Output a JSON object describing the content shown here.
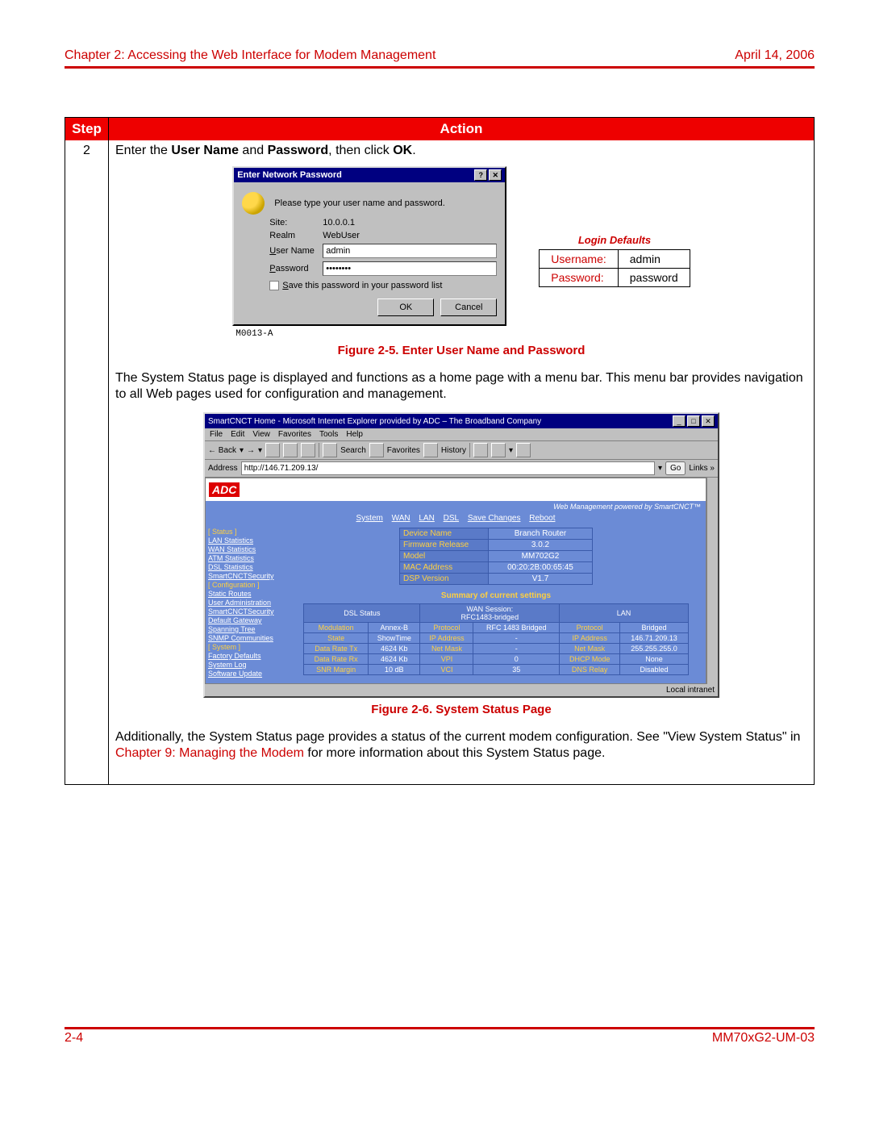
{
  "header": {
    "chapter": "Chapter 2: Accessing the Web Interface for Modem Management",
    "date": "April 14, 2006"
  },
  "table": {
    "header_step": "Step",
    "header_action": "Action",
    "step_num": "2",
    "step_intro_pre": "Enter the ",
    "step_intro_b1": "User Name",
    "step_intro_mid": " and ",
    "step_intro_b2": "Password",
    "step_intro_mid2": ", then click ",
    "step_intro_b3": "OK",
    "step_intro_end": "."
  },
  "dialog": {
    "title": "Enter Network Password",
    "help_btn": "?",
    "close_btn": "✕",
    "prompt": "Please type your user name and password.",
    "site_label": "Site:",
    "site_value": "10.0.0.1",
    "realm_label": "Realm",
    "realm_value": "WebUser",
    "user_label_pre": "U",
    "user_label": "ser Name",
    "user_value": "admin",
    "pass_label_pre": "P",
    "pass_label": "assword",
    "pass_value": "••••••••",
    "save_pre": "S",
    "save_label": "ave this password in your password list",
    "ok_btn": "OK",
    "cancel_btn": "Cancel",
    "code": "M0013-A"
  },
  "defaults": {
    "title": "Login Defaults",
    "user_label": "Username:",
    "user_value": "admin",
    "pass_label": "Password:",
    "pass_value": "password"
  },
  "caption1": "Figure 2-5. Enter User Name and Password",
  "paragraph1": "The System Status page is displayed and functions as a home page with a menu bar. This menu bar provides navigation to all Web pages used for configuration and management.",
  "browser": {
    "title": "SmartCNCT Home - Microsoft Internet Explorer provided by ADC – The Broadband Company",
    "min": "_",
    "max": "□",
    "close": "✕",
    "menu": [
      "File",
      "Edit",
      "View",
      "Favorites",
      "Tools",
      "Help"
    ],
    "back": "← Back",
    "fwd": "→",
    "search": "Search",
    "favorites": "Favorites",
    "history": "History",
    "addr_label": "Address",
    "addr_value": "http://146.71.209.13/",
    "go": "Go",
    "links": "Links »",
    "logo": "ADC",
    "tagline": "Web Management powered by SmartCNCT™",
    "topnav": [
      "System",
      "WAN",
      "LAN",
      "DSL",
      "Save Changes",
      "Reboot"
    ],
    "sidebar": {
      "cat_status": "[ Status ]",
      "items1": [
        "LAN Statistics",
        "WAN Statistics",
        "ATM Statistics",
        "DSL Statistics",
        "SmartCNCTSecurity"
      ],
      "cat_config": "[ Configuration ]",
      "items2": [
        "Static Routes",
        "User Administration",
        "SmartCNCTSecurity",
        "Default Gateway",
        "Spanning Tree",
        "SNMP Communities"
      ],
      "cat_system": "[ System ]",
      "items3": [
        "Factory Defaults",
        "System Log",
        "Software Update"
      ]
    },
    "info": {
      "device_name_k": "Device Name",
      "device_name_v": "Branch Router",
      "fw_k": "Firmware Release",
      "fw_v": "3.0.2",
      "model_k": "Model",
      "model_v": "MM702G2",
      "mac_k": "MAC Address",
      "mac_v": "00:20:2B:00:65:45",
      "dsp_k": "DSP Version",
      "dsp_v": "V1.7"
    },
    "summary_title": "Summary of current settings",
    "sum": {
      "h_dsl": "DSL Status",
      "h_wan": "WAN Session:",
      "h_wan2": "RFC1483-bridged",
      "h_lan": "LAN",
      "r1": {
        "a": "Modulation",
        "b": "Annex-B",
        "c": "Protocol",
        "d": "RFC 1483 Bridged",
        "e": "Protocol",
        "f": "Bridged"
      },
      "r2": {
        "a": "State",
        "b": "ShowTime",
        "c": "IP Address",
        "d": "-",
        "e": "IP Address",
        "f": "146.71.209.13"
      },
      "r3": {
        "a": "Data Rate Tx",
        "b": "4624 Kb",
        "c": "Net Mask",
        "d": "-",
        "e": "Net Mask",
        "f": "255.255.255.0"
      },
      "r4": {
        "a": "Data Rate Rx",
        "b": "4624 Kb",
        "c": "VPI",
        "d": "0",
        "e": "DHCP Mode",
        "f": "None"
      },
      "r5": {
        "a": "SNR Margin",
        "b": "10 dB",
        "c": "VCI",
        "d": "35",
        "e": "DNS Relay",
        "f": "Disabled"
      }
    },
    "status_left": "",
    "status_right": "Local intranet"
  },
  "caption2": "Figure 2-6. System Status Page",
  "paragraph2_a": "Additionally, the System Status page provides a status of the current modem configuration. See \"View System Status\" in ",
  "paragraph2_link": "Chapter 9: Managing the Modem",
  "paragraph2_b": " for more information about this System Status page.",
  "footer": {
    "page": "2-4",
    "docid": "MM70xG2-UM-03"
  }
}
